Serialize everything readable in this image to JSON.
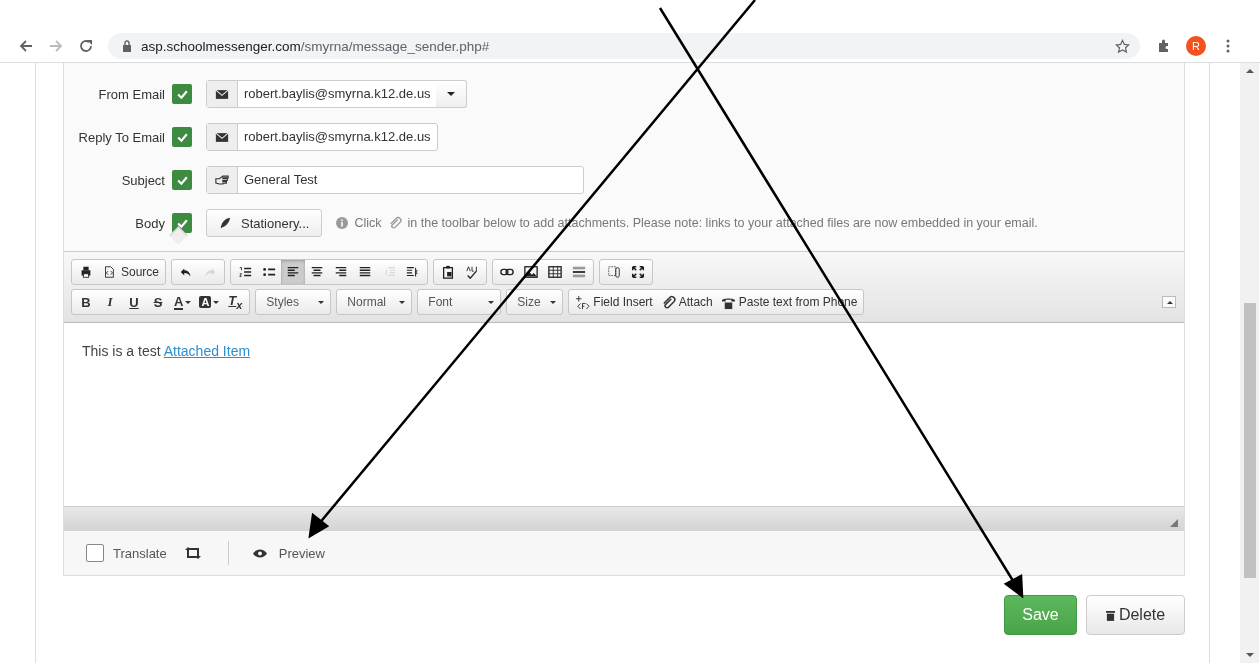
{
  "browser": {
    "url_host": "asp.schoolmessenger.com",
    "url_path": "/smyrna/message_sender.php#",
    "avatar": "R"
  },
  "fields": [
    {
      "label": "From Email",
      "checked": true,
      "kind": "email-dropdown",
      "value": "robert.baylis@smyrna.k12.de.us"
    },
    {
      "label": "Reply To Email",
      "checked": true,
      "kind": "email",
      "value": "robert.baylis@smyrna.k12.de.us"
    },
    {
      "label": "Subject",
      "checked": true,
      "kind": "text",
      "value": "General Test"
    },
    {
      "label": "Body",
      "checked": true,
      "kind": "stationery",
      "value": "Stationery..."
    }
  ],
  "info": {
    "before": "Click",
    "after": "in the toolbar below to add attachments. Please note: links to your attached files are now embedded in your email."
  },
  "toolbar_row1": [
    [
      {
        "kind": "print",
        "selected": false,
        "disabled": false
      },
      {
        "kind": "source",
        "label": "Source",
        "selected": false,
        "disabled": false
      }
    ],
    [
      {
        "kind": "undo",
        "selected": false,
        "disabled": false
      },
      {
        "kind": "redo",
        "selected": false,
        "disabled": true
      }
    ],
    [
      {
        "kind": "numlist",
        "selected": false,
        "disabled": false
      },
      {
        "kind": "bullist",
        "selected": false,
        "disabled": false
      },
      {
        "kind": "alignleft",
        "selected": true,
        "disabled": false
      },
      {
        "kind": "aligncenter",
        "selected": false,
        "disabled": false
      },
      {
        "kind": "alignright",
        "selected": false,
        "disabled": false
      },
      {
        "kind": "justify",
        "selected": false,
        "disabled": false
      },
      {
        "kind": "outdent",
        "selected": false,
        "disabled": true
      },
      {
        "kind": "indent",
        "selected": false,
        "disabled": false
      }
    ],
    [
      {
        "kind": "pasteword",
        "selected": false,
        "disabled": false
      },
      {
        "kind": "spell",
        "selected": false,
        "disabled": false
      }
    ],
    [
      {
        "kind": "link",
        "selected": false,
        "disabled": false
      },
      {
        "kind": "image",
        "selected": false,
        "disabled": false
      },
      {
        "kind": "table",
        "selected": false,
        "disabled": false
      },
      {
        "kind": "hrule",
        "selected": false,
        "disabled": false
      }
    ],
    [
      {
        "kind": "blocks",
        "selected": false,
        "disabled": false
      },
      {
        "kind": "maximize",
        "selected": false,
        "disabled": false
      }
    ]
  ],
  "format_buttons": [
    {
      "kind": "bold",
      "label": "B"
    },
    {
      "kind": "italic",
      "label": "I"
    },
    {
      "kind": "underline",
      "label": "U"
    },
    {
      "kind": "strike",
      "label": "S"
    },
    {
      "kind": "textcolor",
      "label": "A"
    },
    {
      "kind": "bgcolor",
      "label": "A"
    },
    {
      "kind": "removeformat",
      "label": "T$_{x}$"
    }
  ],
  "dropdowns": [
    {
      "label": "Styles"
    },
    {
      "label": "Normal"
    },
    {
      "label": "Font"
    },
    {
      "label": "Size"
    }
  ],
  "plugins": [
    {
      "kind": "field",
      "label": "Field Insert"
    },
    {
      "kind": "attach",
      "label": "Attach"
    },
    {
      "kind": "phone",
      "label": "Paste text from Phone"
    }
  ],
  "editor": {
    "text": "This is a test",
    "link": "Attached Item"
  },
  "footer": {
    "translate": {
      "label": "Translate",
      "checked": false
    },
    "preview": "Preview"
  },
  "buttons": {
    "save": "Save",
    "delete": "Delete"
  }
}
